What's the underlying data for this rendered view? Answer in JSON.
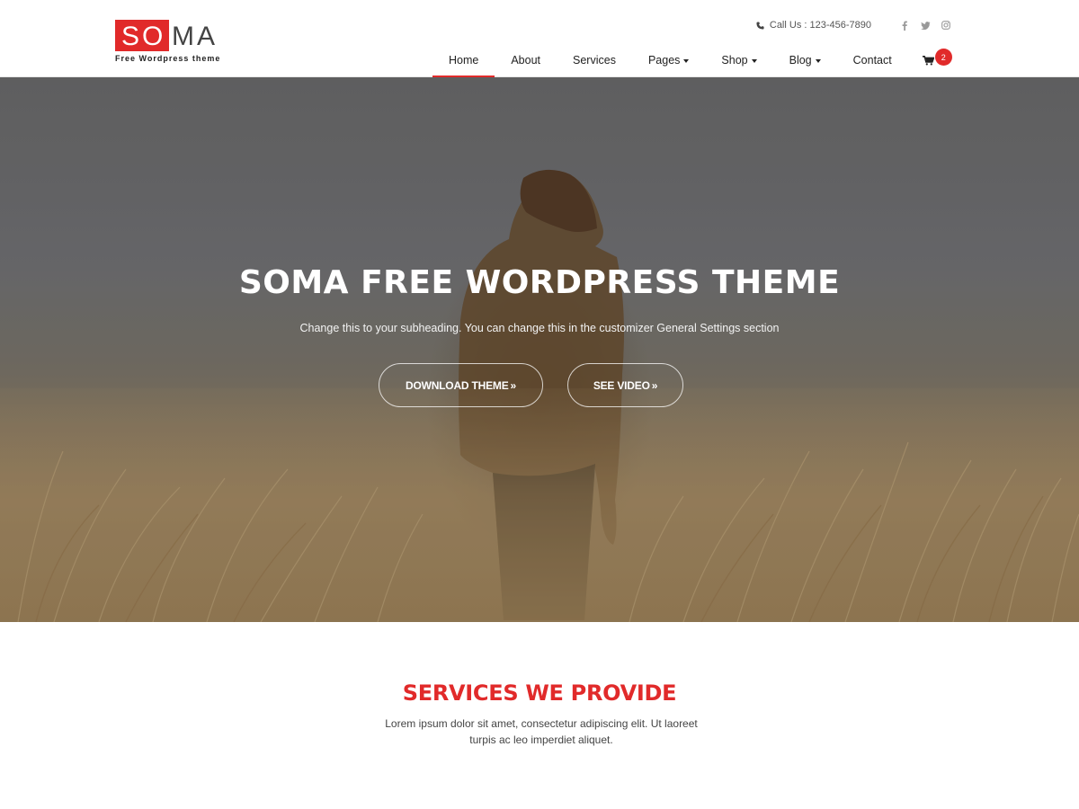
{
  "header": {
    "logo_red": "SO",
    "logo_rest": "MA",
    "tagline": "Free Wordpress theme",
    "phone": "Call Us : 123-456-7890",
    "social_icons": [
      "facebook-icon",
      "twitter-icon",
      "instagram-icon"
    ],
    "nav": [
      {
        "label": "Home",
        "active": true,
        "dropdown": false
      },
      {
        "label": "About",
        "active": false,
        "dropdown": false
      },
      {
        "label": "Services",
        "active": false,
        "dropdown": false
      },
      {
        "label": "Pages",
        "active": false,
        "dropdown": true
      },
      {
        "label": "Shop",
        "active": false,
        "dropdown": true
      },
      {
        "label": "Blog",
        "active": false,
        "dropdown": true
      },
      {
        "label": "Contact",
        "active": false,
        "dropdown": false
      }
    ],
    "cart_count": "2"
  },
  "hero": {
    "title": "SOMA FREE WORDPRESS THEME",
    "subtitle": "Change this to your subheading. You can change this in the customizer General Settings section",
    "btn_download": "DOWNLOAD THEME",
    "btn_video": "SEE VIDEO",
    "chevron": "»"
  },
  "services": {
    "title": "SERVICES WE PROVIDE",
    "text": "Lorem ipsum dolor sit amet, consectetur adipiscing elit. Ut laoreet turpis ac leo imperdiet aliquet."
  },
  "colors": {
    "accent": "#e12a2a",
    "text": "#222222"
  }
}
